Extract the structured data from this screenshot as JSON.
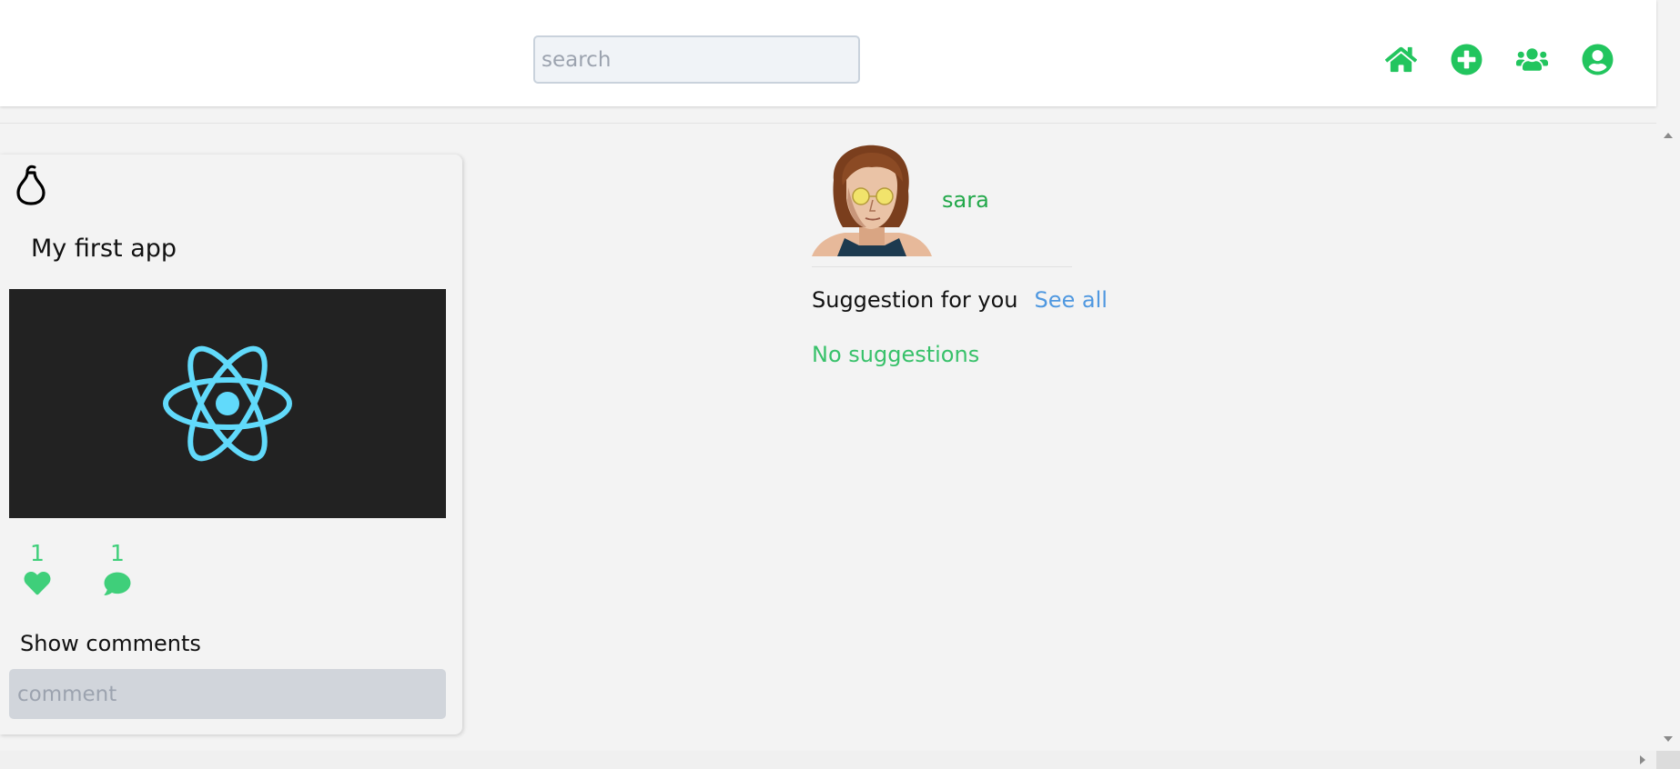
{
  "header": {
    "search": {
      "placeholder": "search",
      "value": ""
    },
    "nav": [
      {
        "name": "home-icon",
        "label": "Home"
      },
      {
        "name": "add-circle-icon",
        "label": "Add"
      },
      {
        "name": "users-icon",
        "label": "Friends"
      },
      {
        "name": "user-circle-icon",
        "label": "Profile"
      }
    ]
  },
  "post": {
    "title": "My first app",
    "image_subject": "react-logo",
    "likes": "1",
    "comments": "1",
    "show_comments_label": "Show comments",
    "comment_input": {
      "placeholder": "comment",
      "value": ""
    }
  },
  "profile": {
    "username": "sara"
  },
  "suggestions": {
    "title": "Suggestion for you",
    "see_all_label": "See all",
    "empty_text": "No suggestions"
  },
  "colors": {
    "accent_green": "#22c55e",
    "link_blue": "#4f98e0",
    "react_cyan": "#61dafb",
    "image_bg": "#222222"
  }
}
